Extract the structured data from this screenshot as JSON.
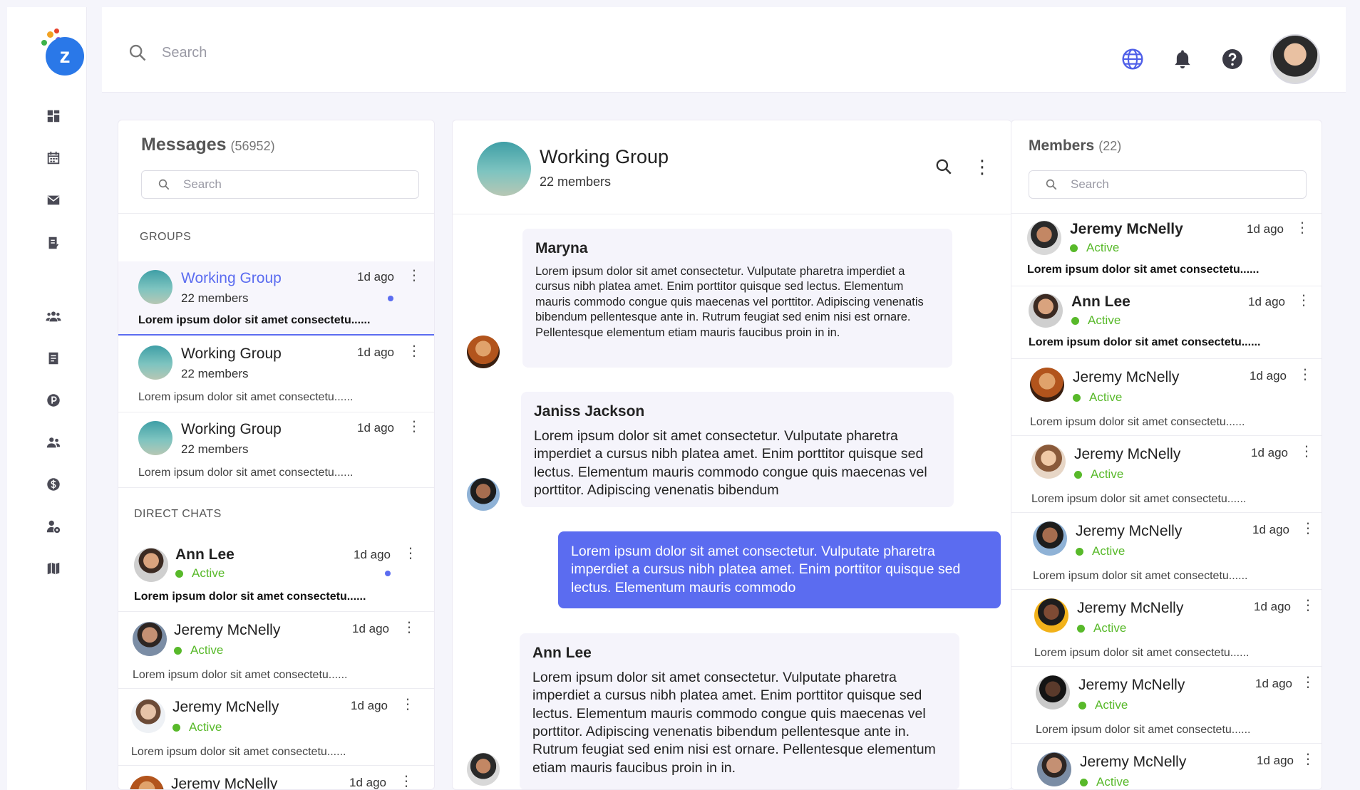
{
  "app": {
    "logo_letter": "z",
    "colors": {
      "accent": "#5b6cf0",
      "active": "#58b92a",
      "logo": "#2a78e8"
    }
  },
  "sidebar": {
    "items": [
      {
        "name": "dashboard-icon"
      },
      {
        "name": "calendar-icon"
      },
      {
        "name": "mail-icon"
      },
      {
        "name": "report-icon"
      },
      {
        "name": "team-icon"
      },
      {
        "name": "document-icon"
      },
      {
        "name": "parking-icon"
      },
      {
        "name": "users-icon"
      },
      {
        "name": "dollar-icon"
      },
      {
        "name": "user-settings-icon"
      },
      {
        "name": "map-icon"
      }
    ]
  },
  "topbar": {
    "search_placeholder": "Search",
    "icons": [
      "globe-icon",
      "bell-icon",
      "help-icon"
    ]
  },
  "messages": {
    "title": "Messages",
    "count": "(56952)",
    "search_placeholder": "Search",
    "groups_label": "GROUPS",
    "direct_label": "DIRECT CHATS",
    "groups": [
      {
        "name": "Working Group",
        "sub": "22 members",
        "time": "1d ago",
        "preview": "Lorem ipsum dolor sit amet consectetu......",
        "active": true,
        "unread": true
      },
      {
        "name": "Working Group",
        "sub": "22 members",
        "time": "1d ago",
        "preview": "Lorem ipsum dolor sit amet consectetu......"
      },
      {
        "name": "Working Group",
        "sub": "22 members",
        "time": "1d ago",
        "preview": "Lorem ipsum dolor sit amet consectetu......"
      }
    ],
    "direct": [
      {
        "name": "Ann Lee",
        "status": "Active",
        "time": "1d ago",
        "preview": "Lorem ipsum dolor sit amet consectetu......",
        "unread": true
      },
      {
        "name": "Jeremy McNelly",
        "status": "Active",
        "time": "1d ago",
        "preview": "Lorem ipsum dolor sit amet consectetu......"
      },
      {
        "name": "Jeremy McNelly",
        "status": "Active",
        "time": "1d ago",
        "preview": "Lorem ipsum dolor sit amet consectetu......"
      },
      {
        "name": "Jeremy McNelly",
        "time": "1d ago"
      }
    ]
  },
  "chat": {
    "title": "Working Group",
    "sub": "22 members",
    "messages": [
      {
        "author": "Maryna",
        "text": "Lorem ipsum dolor sit amet consectetur. Vulputate pharetra imperdiet a cursus nibh platea amet. Enim porttitor quisque sed lectus. Elementum mauris commodo congue quis maecenas vel porttitor. Adipiscing venenatis bibendum pellentesque ante in. Rutrum feugiat sed enim nisi est ornare. Pellentesque elementum etiam mauris faucibus proin in in."
      },
      {
        "author": "Janiss Jackson",
        "text": "Lorem ipsum dolor sit amet consectetur. Vulputate pharetra imperdiet a cursus nibh platea amet. Enim porttitor quisque sed lectus. Elementum mauris commodo congue quis maecenas vel porttitor. Adipiscing venenatis bibendum"
      },
      {
        "author": "",
        "text": "Lorem ipsum dolor sit amet consectetur. Vulputate pharetra imperdiet a cursus nibh platea amet. Enim porttitor quisque sed lectus. Elementum mauris commodo",
        "own": true
      },
      {
        "author": "Ann Lee",
        "text": "Lorem ipsum dolor sit amet consectetur. Vulputate pharetra imperdiet a cursus nibh platea amet. Enim porttitor quisque sed lectus. Elementum mauris commodo congue quis maecenas vel porttitor. Adipiscing venenatis bibendum pellentesque ante in. Rutrum feugiat sed enim nisi est ornare. Pellentesque elementum etiam mauris faucibus proin in in."
      }
    ]
  },
  "members": {
    "title": "Members",
    "count": "(22)",
    "search_placeholder": "Search",
    "items": [
      {
        "name": "Jeremy McNelly",
        "status": "Active",
        "time": "1d ago",
        "preview": "Lorem ipsum dolor sit amet consectetu......"
      },
      {
        "name": "Ann Lee",
        "status": "Active",
        "time": "1d ago",
        "preview": "Lorem ipsum dolor sit amet consectetu......"
      },
      {
        "name": "Jeremy McNelly",
        "status": "Active",
        "time": "1d ago",
        "preview": "Lorem ipsum dolor sit amet consectetu......"
      },
      {
        "name": "Jeremy McNelly",
        "status": "Active",
        "time": "1d ago",
        "preview": "Lorem ipsum dolor sit amet consectetu......"
      },
      {
        "name": "Jeremy McNelly",
        "status": "Active",
        "time": "1d ago",
        "preview": "Lorem ipsum dolor sit amet consectetu......"
      },
      {
        "name": "Jeremy McNelly",
        "status": "Active",
        "time": "1d ago",
        "preview": "Lorem ipsum dolor sit amet consectetu......"
      },
      {
        "name": "Jeremy McNelly",
        "status": "Active",
        "time": "1d ago",
        "preview": "Lorem ipsum dolor sit amet consectetu......"
      },
      {
        "name": "Jeremy McNelly",
        "status": "Active",
        "time": "1d ago"
      }
    ]
  }
}
